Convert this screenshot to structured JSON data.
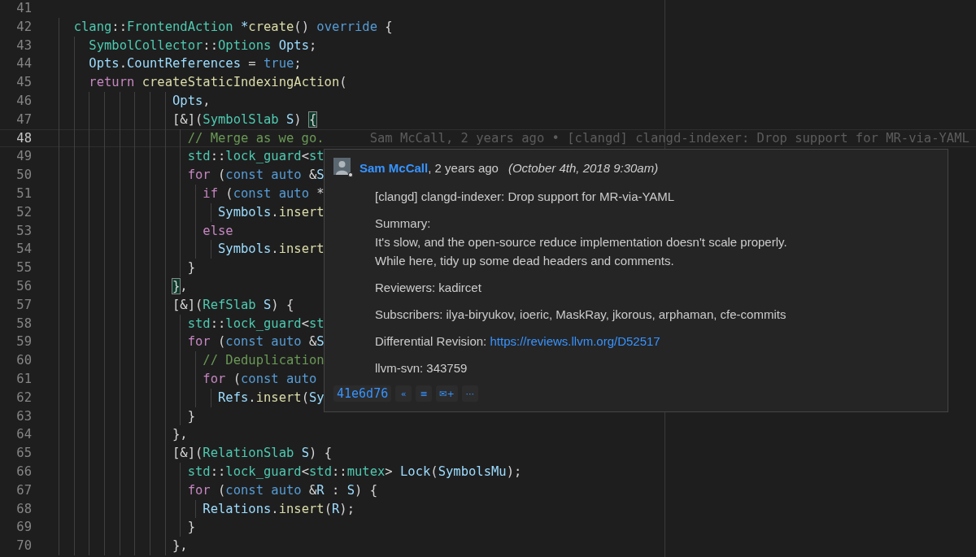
{
  "editor": {
    "lines": [
      {
        "number": "41",
        "current": false
      },
      {
        "number": "42",
        "current": false,
        "tokens": [
          {
            "kind": "type",
            "text": "  clang"
          },
          {
            "kind": "plain",
            "text": "::"
          },
          {
            "kind": "type",
            "text": "FrontendAction"
          },
          {
            "kind": "var",
            "text": " *"
          },
          {
            "kind": "func",
            "text": "create"
          },
          {
            "kind": "plain",
            "text": "() "
          },
          {
            "kind": "keyword",
            "text": "override"
          },
          {
            "kind": "plain",
            "text": " {"
          }
        ]
      },
      {
        "number": "43",
        "current": false,
        "tokens": [
          {
            "kind": "type",
            "text": "    SymbolCollector"
          },
          {
            "kind": "plain",
            "text": "::"
          },
          {
            "kind": "type",
            "text": "Options"
          },
          {
            "kind": "var",
            "text": " Opts"
          },
          {
            "kind": "plain",
            "text": ";"
          }
        ]
      },
      {
        "number": "44",
        "current": false,
        "tokens": [
          {
            "kind": "var",
            "text": "    Opts"
          },
          {
            "kind": "plain",
            "text": "."
          },
          {
            "kind": "var",
            "text": "CountReferences"
          },
          {
            "kind": "plain",
            "text": " = "
          },
          {
            "kind": "keyword",
            "text": "true"
          },
          {
            "kind": "plain",
            "text": ";"
          }
        ]
      },
      {
        "number": "45",
        "current": false,
        "tokens": [
          {
            "kind": "control",
            "text": "    return"
          },
          {
            "kind": "func",
            "text": " createStaticIndexingAction"
          },
          {
            "kind": "plain",
            "text": "("
          }
        ]
      },
      {
        "number": "46",
        "current": false,
        "tokens": [
          {
            "kind": "var",
            "text": "               Opts"
          },
          {
            "kind": "plain",
            "text": ","
          }
        ]
      },
      {
        "number": "47",
        "current": false,
        "tokens": [
          {
            "kind": "plain",
            "text": "               [&]("
          },
          {
            "kind": "type",
            "text": "SymbolSlab"
          },
          {
            "kind": "var",
            "text": " S"
          },
          {
            "kind": "plain",
            "text": ") "
          },
          {
            "kind": "match",
            "text": "{"
          }
        ]
      },
      {
        "number": "48",
        "current": true,
        "blame": "Sam McCall, 2 years ago • [clangd] clangd-indexer: Drop support for MR-via-YAML",
        "tokens": [
          {
            "kind": "comment",
            "text": "                 // Merge as we go."
          }
        ]
      },
      {
        "number": "49",
        "current": false,
        "tokens": [
          {
            "kind": "type",
            "text": "                 std"
          },
          {
            "kind": "plain",
            "text": "::"
          },
          {
            "kind": "type",
            "text": "lock_guard"
          },
          {
            "kind": "plain",
            "text": "<"
          },
          {
            "kind": "type",
            "text": "st"
          }
        ]
      },
      {
        "number": "50",
        "current": false,
        "tokens": [
          {
            "kind": "control",
            "text": "                 for"
          },
          {
            "kind": "plain",
            "text": " ("
          },
          {
            "kind": "keyword",
            "text": "const"
          },
          {
            "kind": "keyword",
            "text": " auto"
          },
          {
            "kind": "plain",
            "text": " &"
          },
          {
            "kind": "var",
            "text": "S"
          }
        ]
      },
      {
        "number": "51",
        "current": false,
        "tokens": [
          {
            "kind": "control",
            "text": "                   if"
          },
          {
            "kind": "plain",
            "text": " ("
          },
          {
            "kind": "keyword",
            "text": "const"
          },
          {
            "kind": "keyword",
            "text": " auto"
          },
          {
            "kind": "plain",
            "text": " *"
          }
        ]
      },
      {
        "number": "52",
        "current": false,
        "tokens": [
          {
            "kind": "var",
            "text": "                     Symbols"
          },
          {
            "kind": "plain",
            "text": "."
          },
          {
            "kind": "func",
            "text": "insert"
          }
        ]
      },
      {
        "number": "53",
        "current": false,
        "tokens": [
          {
            "kind": "control",
            "text": "                   else"
          }
        ]
      },
      {
        "number": "54",
        "current": false,
        "tokens": [
          {
            "kind": "var",
            "text": "                     Symbols"
          },
          {
            "kind": "plain",
            "text": "."
          },
          {
            "kind": "func",
            "text": "insert"
          }
        ]
      },
      {
        "number": "55",
        "current": false,
        "tokens": [
          {
            "kind": "plain",
            "text": "                 }"
          }
        ]
      },
      {
        "number": "56",
        "current": false,
        "tokens": [
          {
            "kind": "match",
            "text": "               }"
          },
          {
            "kind": "plain",
            "text": ","
          }
        ]
      },
      {
        "number": "57",
        "current": false,
        "tokens": [
          {
            "kind": "plain",
            "text": "               [&]("
          },
          {
            "kind": "type",
            "text": "RefSlab"
          },
          {
            "kind": "var",
            "text": " S"
          },
          {
            "kind": "plain",
            "text": ") {"
          }
        ]
      },
      {
        "number": "58",
        "current": false,
        "tokens": [
          {
            "kind": "type",
            "text": "                 std"
          },
          {
            "kind": "plain",
            "text": "::"
          },
          {
            "kind": "type",
            "text": "lock_guard"
          },
          {
            "kind": "plain",
            "text": "<"
          },
          {
            "kind": "type",
            "text": "st"
          }
        ]
      },
      {
        "number": "59",
        "current": false,
        "tokens": [
          {
            "kind": "control",
            "text": "                 for"
          },
          {
            "kind": "plain",
            "text": " ("
          },
          {
            "kind": "keyword",
            "text": "const"
          },
          {
            "kind": "keyword",
            "text": " auto"
          },
          {
            "kind": "plain",
            "text": " &"
          },
          {
            "kind": "var",
            "text": "S"
          }
        ]
      },
      {
        "number": "60",
        "current": false,
        "tokens": [
          {
            "kind": "comment",
            "text": "                   // Deduplication"
          }
        ]
      },
      {
        "number": "61",
        "current": false,
        "tokens": [
          {
            "kind": "control",
            "text": "                   for"
          },
          {
            "kind": "plain",
            "text": " ("
          },
          {
            "kind": "keyword",
            "text": "const"
          },
          {
            "kind": "keyword",
            "text": " auto"
          }
        ]
      },
      {
        "number": "62",
        "current": false,
        "tokens": [
          {
            "kind": "var",
            "text": "                     Refs"
          },
          {
            "kind": "plain",
            "text": "."
          },
          {
            "kind": "func",
            "text": "insert"
          },
          {
            "kind": "plain",
            "text": "("
          },
          {
            "kind": "var",
            "text": "Sy"
          }
        ]
      },
      {
        "number": "63",
        "current": false,
        "tokens": [
          {
            "kind": "plain",
            "text": "                 }"
          }
        ]
      },
      {
        "number": "64",
        "current": false,
        "tokens": [
          {
            "kind": "plain",
            "text": "               },"
          }
        ]
      },
      {
        "number": "65",
        "current": false,
        "tokens": [
          {
            "kind": "plain",
            "text": "               [&]("
          },
          {
            "kind": "type",
            "text": "RelationSlab"
          },
          {
            "kind": "var",
            "text": " S"
          },
          {
            "kind": "plain",
            "text": ") {"
          }
        ]
      },
      {
        "number": "66",
        "current": false,
        "tokens": [
          {
            "kind": "type",
            "text": "                 std"
          },
          {
            "kind": "plain",
            "text": "::"
          },
          {
            "kind": "type",
            "text": "lock_guard"
          },
          {
            "kind": "plain",
            "text": "<"
          },
          {
            "kind": "type",
            "text": "std"
          },
          {
            "kind": "plain",
            "text": "::"
          },
          {
            "kind": "type",
            "text": "mutex"
          },
          {
            "kind": "plain",
            "text": "> "
          },
          {
            "kind": "var",
            "text": "Lock"
          },
          {
            "kind": "plain",
            "text": "("
          },
          {
            "kind": "var",
            "text": "SymbolsMu"
          },
          {
            "kind": "plain",
            "text": ");"
          }
        ]
      },
      {
        "number": "67",
        "current": false,
        "tokens": [
          {
            "kind": "control",
            "text": "                 for"
          },
          {
            "kind": "plain",
            "text": " ("
          },
          {
            "kind": "keyword",
            "text": "const"
          },
          {
            "kind": "keyword",
            "text": " auto"
          },
          {
            "kind": "plain",
            "text": " &"
          },
          {
            "kind": "var",
            "text": "R"
          },
          {
            "kind": "plain",
            "text": " : "
          },
          {
            "kind": "var",
            "text": "S"
          },
          {
            "kind": "plain",
            "text": ") {"
          }
        ]
      },
      {
        "number": "68",
        "current": false,
        "tokens": [
          {
            "kind": "var",
            "text": "                   Relations"
          },
          {
            "kind": "plain",
            "text": "."
          },
          {
            "kind": "func",
            "text": "insert"
          },
          {
            "kind": "plain",
            "text": "("
          },
          {
            "kind": "var",
            "text": "R"
          },
          {
            "kind": "plain",
            "text": ");"
          }
        ]
      },
      {
        "number": "69",
        "current": false,
        "tokens": [
          {
            "kind": "plain",
            "text": "                 }"
          }
        ]
      },
      {
        "number": "70",
        "current": false,
        "tokens": [
          {
            "kind": "plain",
            "text": "               },"
          }
        ]
      }
    ]
  },
  "blame_popup": {
    "author": "Sam McCall",
    "age": ", 2 years ago",
    "date": "(October 4th, 2018 9:30am)",
    "title": "[clangd] clangd-indexer: Drop support for MR-via-YAML",
    "paragraphs": [
      {
        "lines": [
          "Summary:",
          "It's slow, and the open-source reduce implementation doesn't scale properly.",
          "While here, tidy up some dead headers and comments."
        ]
      },
      {
        "lines": [
          "Reviewers: kadircet"
        ]
      },
      {
        "lines": [
          "Subscribers: ilya-biryukov, ioeric, MaskRay, jkorous, arphaman, cfe-commits"
        ]
      },
      {
        "lines": [
          "Differential Revision:"
        ],
        "link": "https://reviews.llvm.org/D52517"
      },
      {
        "lines": [
          "llvm-svn: 343759"
        ]
      }
    ],
    "commit_sha": "41e6d76",
    "actions": [
      {
        "label": "«"
      },
      {
        "label": "≡"
      },
      {
        "label": "✉+"
      },
      {
        "label": "···"
      }
    ]
  }
}
